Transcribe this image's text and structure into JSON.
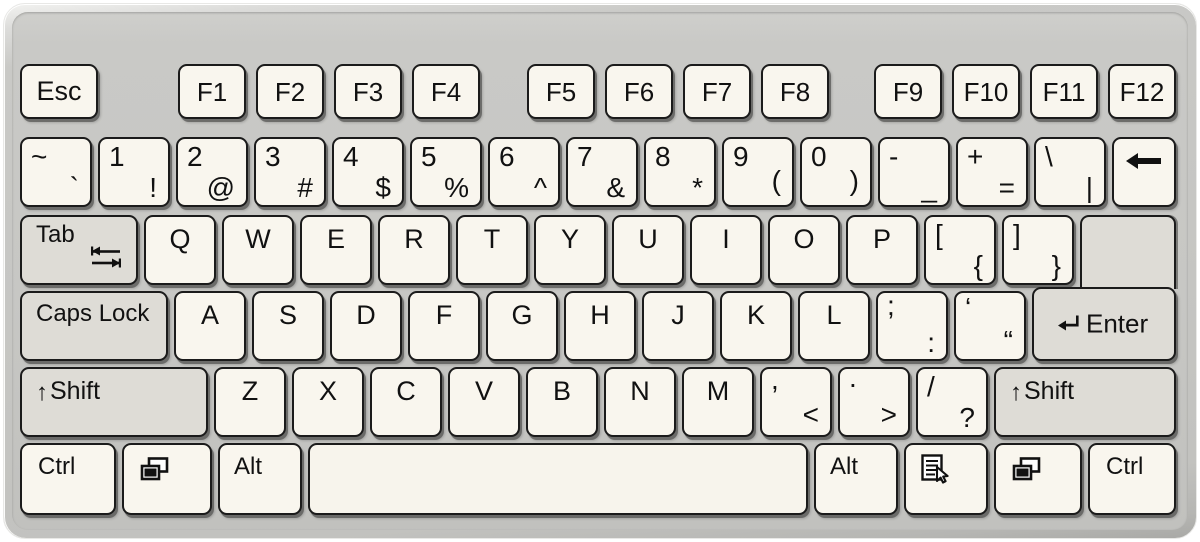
{
  "device": {
    "name": "computer-keyboard",
    "layout": "ANSI US QWERTY 12-function-key compact",
    "case_color": "#c6c6c3",
    "key_color": "#f9f6ee",
    "modifier_key_color": "#dedcd6",
    "key_border_color": "#1b1b1b",
    "label_color": "#111111"
  },
  "rows": {
    "function_row": {
      "name": "function-key-row",
      "keys": [
        {
          "name": "esc",
          "label": "Esc"
        },
        {
          "name": "f1",
          "label": "F1"
        },
        {
          "name": "f2",
          "label": "F2"
        },
        {
          "name": "f3",
          "label": "F3"
        },
        {
          "name": "f4",
          "label": "F4"
        },
        {
          "name": "f5",
          "label": "F5"
        },
        {
          "name": "f6",
          "label": "F6"
        },
        {
          "name": "f7",
          "label": "F7"
        },
        {
          "name": "f8",
          "label": "F8"
        },
        {
          "name": "f9",
          "label": "F9"
        },
        {
          "name": "f10",
          "label": "F10"
        },
        {
          "name": "f11",
          "label": "F11"
        },
        {
          "name": "f12",
          "label": "F12"
        }
      ]
    },
    "number_row": {
      "name": "number-row",
      "keys": [
        {
          "name": "backtick",
          "primary": "~",
          "secondary": "`"
        },
        {
          "name": "digit-1",
          "primary": "1",
          "secondary": "!"
        },
        {
          "name": "digit-2",
          "primary": "2",
          "secondary": "@"
        },
        {
          "name": "digit-3",
          "primary": "3",
          "secondary": "#"
        },
        {
          "name": "digit-4",
          "primary": "4",
          "secondary": "$"
        },
        {
          "name": "digit-5",
          "primary": "5",
          "secondary": "%"
        },
        {
          "name": "digit-6",
          "primary": "6",
          "secondary": "^"
        },
        {
          "name": "digit-7",
          "primary": "7",
          "secondary": "&"
        },
        {
          "name": "digit-8",
          "primary": "8",
          "secondary": "*"
        },
        {
          "name": "digit-9",
          "primary": "9",
          "secondary": "("
        },
        {
          "name": "digit-0",
          "primary": "0",
          "secondary": ")"
        },
        {
          "name": "minus",
          "primary": "-",
          "secondary": "_"
        },
        {
          "name": "equals",
          "primary": "+",
          "secondary": "="
        },
        {
          "name": "backslash",
          "primary": "\\",
          "secondary": "|"
        },
        {
          "name": "backspace",
          "icon": "left-arrow-icon"
        }
      ]
    },
    "tab_row": {
      "name": "tab-row",
      "tab_label": "Tab",
      "tab_icon": "tab-arrows-icon",
      "keys": [
        {
          "name": "q",
          "label": "Q"
        },
        {
          "name": "w",
          "label": "W"
        },
        {
          "name": "e",
          "label": "E"
        },
        {
          "name": "r",
          "label": "R"
        },
        {
          "name": "t",
          "label": "T"
        },
        {
          "name": "y",
          "label": "Y"
        },
        {
          "name": "u",
          "label": "U"
        },
        {
          "name": "i",
          "label": "I"
        },
        {
          "name": "o",
          "label": "O"
        },
        {
          "name": "p",
          "label": "P"
        }
      ],
      "bracket_keys": [
        {
          "name": "bracket-left",
          "primary": "[",
          "secondary": "{"
        },
        {
          "name": "bracket-right",
          "primary": "]",
          "secondary": "}"
        }
      ]
    },
    "home_row": {
      "name": "home-row",
      "caps_lock_label": "Caps Lock",
      "keys": [
        {
          "name": "a",
          "label": "A"
        },
        {
          "name": "s",
          "label": "S"
        },
        {
          "name": "d",
          "label": "D"
        },
        {
          "name": "f",
          "label": "F"
        },
        {
          "name": "g",
          "label": "G"
        },
        {
          "name": "h",
          "label": "H"
        },
        {
          "name": "j",
          "label": "J"
        },
        {
          "name": "k",
          "label": "K"
        },
        {
          "name": "l",
          "label": "L"
        }
      ],
      "punct_keys": [
        {
          "name": "semicolon",
          "primary": ";",
          "secondary": ":"
        },
        {
          "name": "quote",
          "primary": "‘",
          "secondary": "“"
        }
      ],
      "enter_label": "Enter",
      "enter_icon": "enter-arrow-icon"
    },
    "shift_row": {
      "name": "shift-row",
      "left_shift_label": "Shift",
      "right_shift_label": "Shift",
      "shift_icon": "up-arrow-icon",
      "keys": [
        {
          "name": "z",
          "label": "Z"
        },
        {
          "name": "x",
          "label": "X"
        },
        {
          "name": "c",
          "label": "C"
        },
        {
          "name": "v",
          "label": "V"
        },
        {
          "name": "b",
          "label": "B"
        },
        {
          "name": "n",
          "label": "N"
        },
        {
          "name": "m",
          "label": "M"
        }
      ],
      "punct_keys": [
        {
          "name": "comma",
          "primary": ",",
          "secondary": "<"
        },
        {
          "name": "period",
          "primary": ".",
          "secondary": ">"
        },
        {
          "name": "slash",
          "primary": "/",
          "secondary": "?"
        }
      ]
    },
    "bottom_row": {
      "name": "bottom-row",
      "keys": [
        {
          "name": "ctrl-left",
          "label": "Ctrl",
          "type": "text"
        },
        {
          "name": "win-left",
          "icon": "windows-icon",
          "type": "icon"
        },
        {
          "name": "alt-left",
          "label": "Alt",
          "type": "text"
        },
        {
          "name": "space",
          "label": "",
          "type": "blank"
        },
        {
          "name": "alt-right",
          "label": "Alt",
          "type": "text"
        },
        {
          "name": "menu",
          "icon": "context-menu-icon",
          "type": "icon"
        },
        {
          "name": "win-right",
          "icon": "windows-icon",
          "type": "icon"
        },
        {
          "name": "ctrl-right",
          "label": "Ctrl",
          "type": "text"
        }
      ]
    }
  }
}
